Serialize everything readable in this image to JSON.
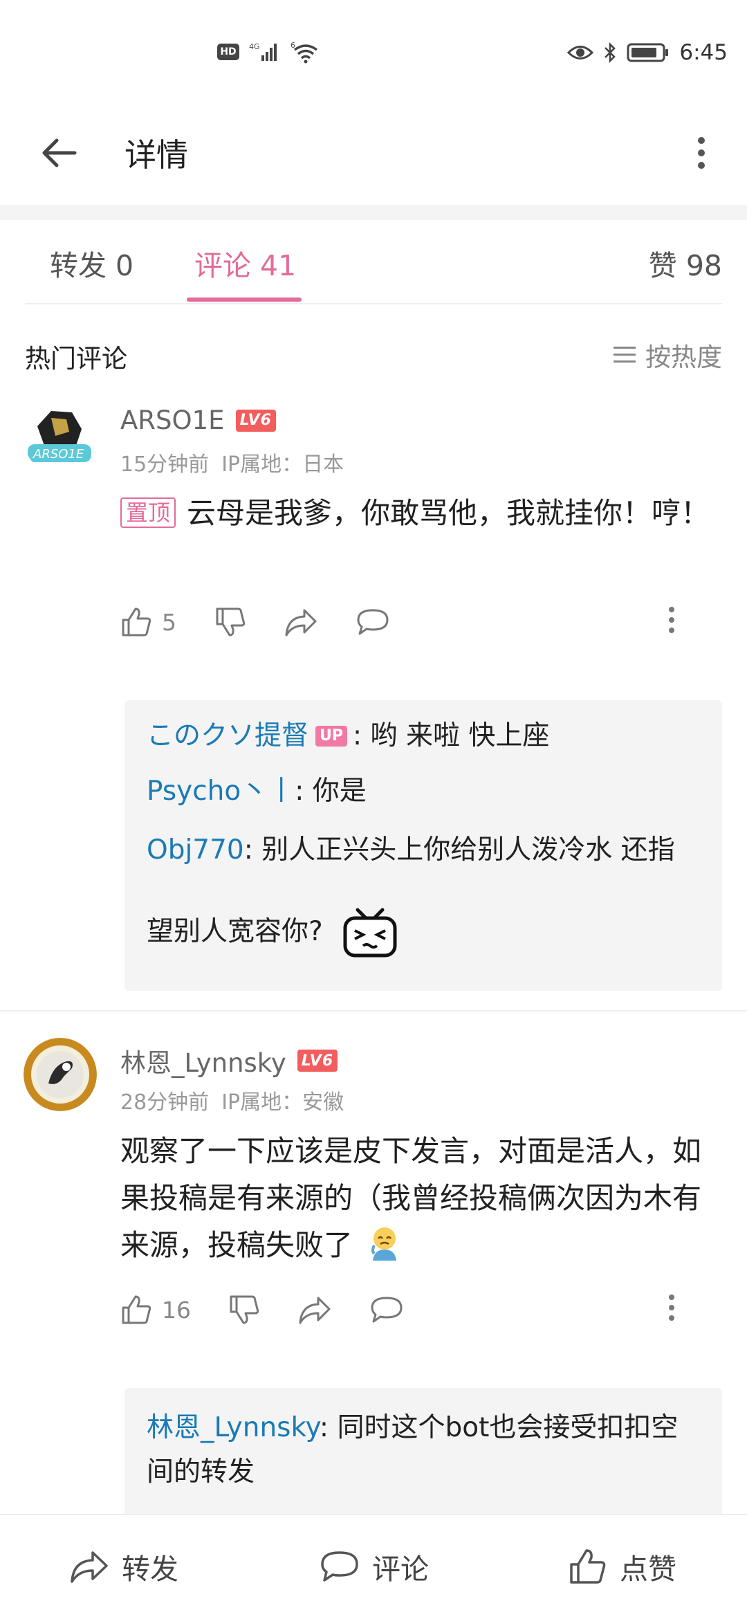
{
  "status_bar": {
    "hd": "HD",
    "network": "4G",
    "wifi": "6",
    "time": "6:45"
  },
  "header": {
    "title": "详情"
  },
  "tabs": {
    "repost": "转发 0",
    "comment": "评论 41",
    "like": "赞 98",
    "active_color": "#e36b97"
  },
  "section": {
    "title": "热门评论",
    "sort_label": "按热度"
  },
  "comments": [
    {
      "username": "ARSO1E",
      "level": "LV6",
      "time": "15分钟前",
      "ip": "IP属地：日本",
      "pinned_label": "置顶",
      "text": "云母是我爹，你敢骂他，我就挂你！哼！",
      "likes": "5",
      "replies": [
        {
          "name": "このクソ提督",
          "badge": "UP",
          "text": ": 哟 来啦 快上座"
        },
        {
          "name": "Psycho丶丨",
          "text": ": 你是"
        },
        {
          "name": "Obj770",
          "text": ": 别人正兴头上你给别人泼冷水 还指望别人宽容你?"
        }
      ]
    },
    {
      "username": "林恩_Lynnsky",
      "level": "LV6",
      "time": "28分钟前",
      "ip": "IP属地：安徽",
      "text": "观察了一下应该是皮下发言，对面是活人，如果投稿是有来源的（我曾经投稿俩次因为木有来源，投稿失败了",
      "likes": "16",
      "replies": [
        {
          "name": "林恩_Lynnsky",
          "text": ": 同时这个bot也会接受扣扣空间的转发"
        }
      ]
    }
  ],
  "bottom_bar": {
    "repost": "转发",
    "comment": "评论",
    "like": "点赞"
  }
}
